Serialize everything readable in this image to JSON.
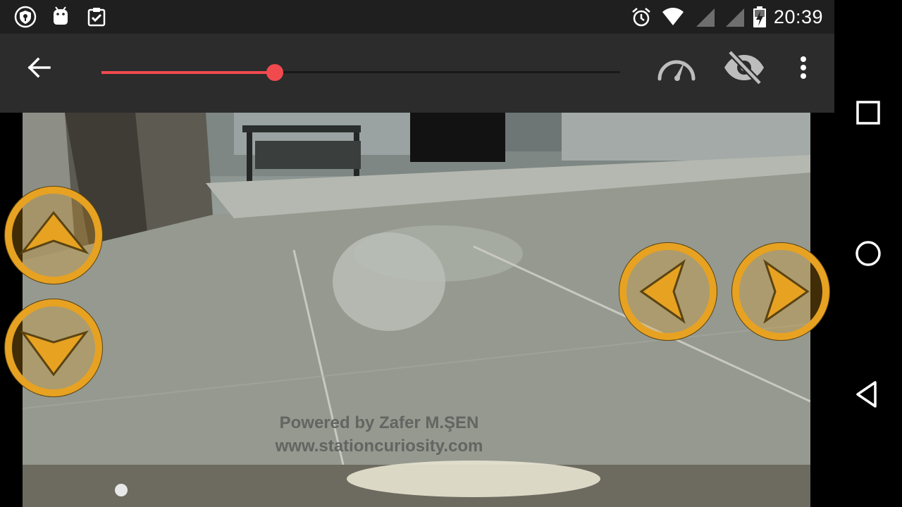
{
  "status_bar": {
    "time": "20:39",
    "left_icons": [
      "vpn-shield-icon",
      "android-icon",
      "clipboard-check-icon"
    ],
    "right_icons": [
      "alarm-icon",
      "wifi-icon",
      "signal-icon",
      "signal-icon",
      "battery-charging-icon"
    ]
  },
  "toolbar": {
    "back_icon": "arrow-left-icon",
    "slider_value_percent": 33.4,
    "slider_color": "#f04a4f",
    "speed_icon": "speedometer-icon",
    "visibility_icon": "eye-off-icon",
    "menu_icon": "more-vert-icon"
  },
  "camera": {
    "watermark_line1": "Powered by Zafer M.ŞEN",
    "watermark_line2": "www.stationcuriosity.com"
  },
  "controls": {
    "accent_color": "#e7a222",
    "buttons": [
      "forward-button",
      "backward-button",
      "left-button",
      "right-button"
    ]
  },
  "navigation": {
    "items": [
      "recents-button",
      "home-button",
      "back-button"
    ]
  }
}
